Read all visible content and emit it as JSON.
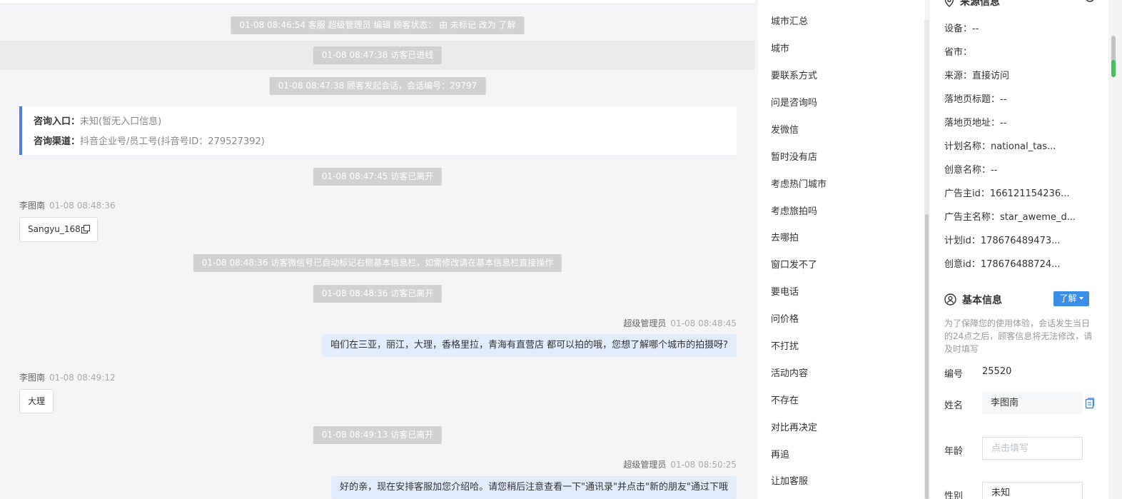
{
  "chat": {
    "system_1": "01-08 08:46:54 客服 超级管理员 编辑 顾客状态： 由 未标记 改为 了解",
    "system_2": "01-08 08:47:38 访客已进线",
    "system_3": "01-08 08:47:38 顾客发起会话，会话编号：29797",
    "entry_label": "咨询入口：",
    "entry_value": "未知(暂无入口信息)",
    "channel_label": "咨询渠道：",
    "channel_value": "抖音企业号/员工号(抖音号ID：279527392)",
    "system_4": "01-08 08:47:45 访客已离开",
    "visitor_name": "李图南",
    "msg1_time": "01-08 08:48:36",
    "msg1_text": "Sangyu_168",
    "system_5": "01-08 08:48:36 访客微信号已自动标记右侧基本信息栏，如需修改请在基本信息栏直接操作",
    "system_6": "01-08 08:48:36 访客已离开",
    "agent_name": "超级管理员",
    "msg2_time": "01-08 08:48:45",
    "msg2_text": "咱们在三亚，丽江，大理，香格里拉，青海有直营店 都可以拍的哦，您想了解哪个城市的拍摄呀?",
    "msg3_time": "01-08 08:49:12",
    "msg3_text": "大理",
    "system_7": "01-08 08:49:13 访客已离开",
    "msg4_time": "01-08 08:50:25",
    "msg4_text": "好的亲，现在安排客服加您介绍哈。请您稍后注意查看一下\"通讯录\"并点击\"新的朋友\"通过下哦"
  },
  "tags": [
    "城市汇总",
    "城市",
    "要联系方式",
    "问是咨询吗",
    "发微信",
    "暂时没有店",
    "考虑热门城市",
    "考虑旅拍吗",
    "去哪拍",
    "窗口发不了",
    "要电话",
    "问价格",
    "不打扰",
    "活动内容",
    "不存在",
    "对比再决定",
    "再追",
    "让加客服"
  ],
  "source": {
    "title": "来源信息",
    "fields": [
      "设备：--",
      "省市：",
      "来源：直接访问",
      "落地页标题：--",
      "落地页地址：--",
      "计划名称：national_tas...",
      "创意名称：--",
      "广告主id：166121154236...",
      "广告主名称：star_aweme_d...",
      "计划id：178676489473...",
      "创意id：178676488724..."
    ]
  },
  "basic": {
    "title": "基本信息",
    "status_tag": "了解",
    "note": "为了保障您的使用体验，会话发生当日的24点之后，顾客信息将无法修改，请及时填写",
    "id_label": "编号",
    "id_value": "25520",
    "name_label": "姓名",
    "name_value": "李图南",
    "age_label": "年龄",
    "age_placeholder": "点击填写",
    "gender_label": "性别",
    "gender_value": "未知"
  },
  "colors": {
    "accent": "#3a8ee6",
    "agent_bubble": "#e1ecfc",
    "system_bubble": "#d1d1d3",
    "entry_border": "#4a7ee8"
  },
  "icons": [
    "location-icon",
    "settings-icon",
    "copy-icon",
    "user-circle-icon",
    "edit-copy-icon",
    "caret-down-icon"
  ]
}
